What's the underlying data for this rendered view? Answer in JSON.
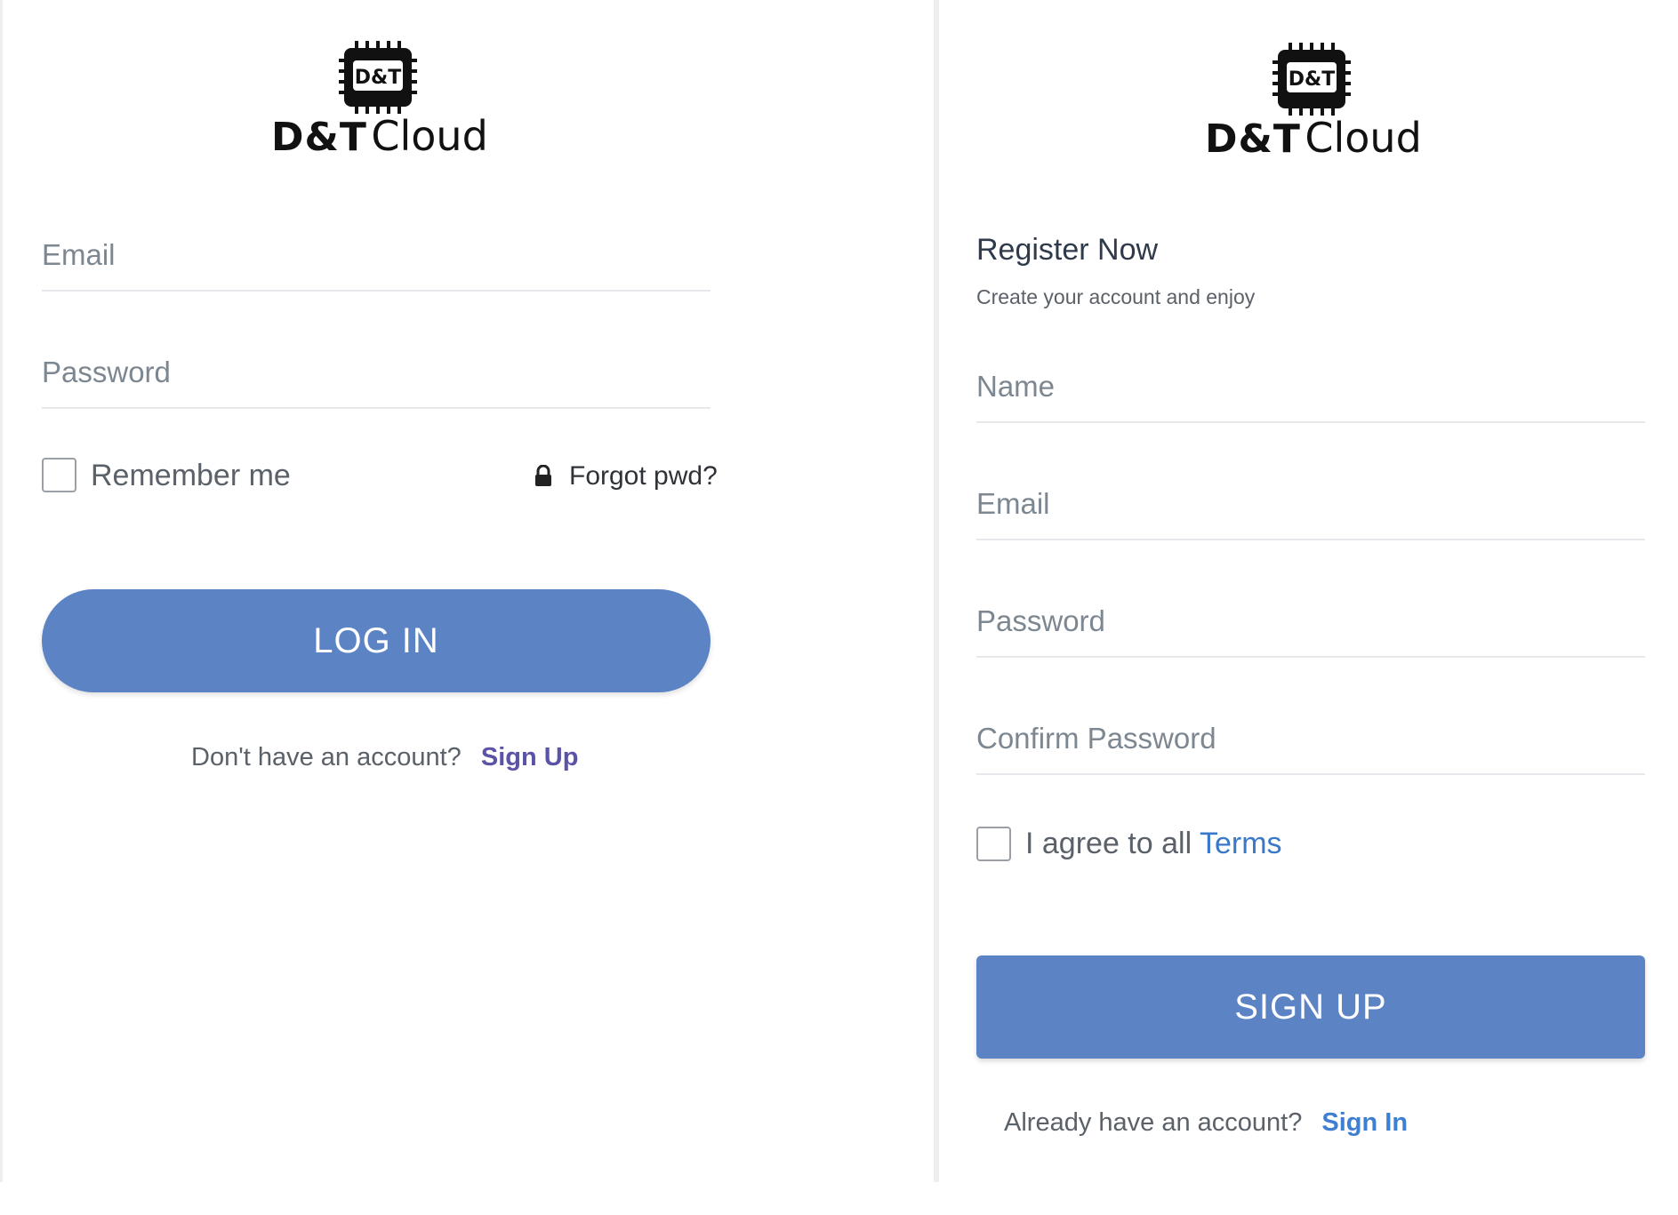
{
  "brand": {
    "chip_label": "D&T",
    "name_part1": "D&T",
    "name_part2": "Cloud"
  },
  "login": {
    "email_placeholder": "Email",
    "password_placeholder": "Password",
    "remember_label": "Remember me",
    "forgot_label": "Forgot pwd?",
    "forgot_icon": "lock-icon",
    "login_button": "LOG IN",
    "no_account_text": "Don't have an account?",
    "signup_link": "Sign Up"
  },
  "register": {
    "title": "Register Now",
    "subtitle": "Create your account and enjoy",
    "name_placeholder": "Name",
    "email_placeholder": "Email",
    "password_placeholder": "Password",
    "confirm_placeholder": "Confirm Password",
    "agree_text": "I agree to all",
    "terms_link": "Terms",
    "signup_button": "SIGN UP",
    "have_account_text": "Already have an account?",
    "signin_link": "Sign In"
  },
  "colors": {
    "button": "#5c84c4",
    "signup_link": "#5b54a6",
    "signin_link": "#3f7fd1",
    "terms_link": "#3a78c9"
  }
}
